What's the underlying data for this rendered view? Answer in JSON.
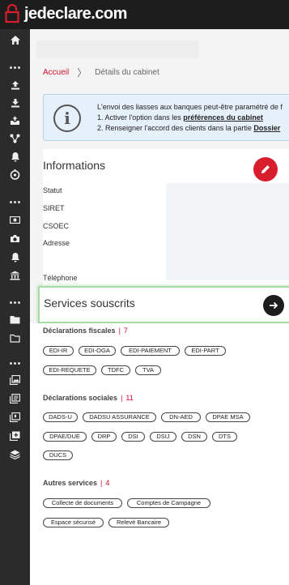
{
  "app": {
    "logo_text": "jedeclare.com"
  },
  "breadcrumb": {
    "home": "Accueil",
    "separator": "〉",
    "current": "Détails du cabinet"
  },
  "info_banner": {
    "line1": "L'envoi des liasses aux banques peut-être paramétré de f",
    "line2_prefix": "1. Activer l'option dans les ",
    "line2_link": "préférences du cabinet",
    "line3_prefix": "2. Renseigner l'accord des clients dans la partie ",
    "line3_link": "Dossier"
  },
  "informations": {
    "title": "Informations",
    "fields": [
      "Statut",
      "SIRET",
      "CSOEC",
      "Adresse",
      "Téléphone"
    ]
  },
  "services": {
    "title": "Services souscrits",
    "groups": [
      {
        "title": "Déclarations fiscales",
        "count": "7",
        "items": [
          "EDI-IR",
          "EDI-OGA",
          "EDI-PAIEMENT",
          "EDI-PART",
          "EDI-REQUETE",
          "TDFC",
          "TVA"
        ]
      },
      {
        "title": "Déclarations sociales",
        "count": "11",
        "items": [
          "DADS-U",
          "DADSU ASSURANCE",
          "DN-AED",
          "DPAE MSA",
          "DPAE/DUE",
          "DRP",
          "DSI",
          "DSIJ",
          "DSN",
          "DTS",
          "DUCS"
        ]
      },
      {
        "title": "Autres services",
        "count": "4",
        "items": [
          "Collecte de documents",
          "Comptes de Campagne",
          "Espace sécurisé",
          "Relevé Bancaire"
        ]
      }
    ]
  },
  "colors": {
    "brand_red": "#c8102e",
    "sidebar": "#2b2b2b",
    "topbar": "#1d1d1d",
    "highlight": "#a6dba6"
  },
  "sidebar_icons": [
    "home-icon",
    "upload-icon",
    "download-icon",
    "inbox-upload-icon",
    "network-icon",
    "bell-icon",
    "compass-icon",
    "cash-icon",
    "camera-icon",
    "bell-icon",
    "bank-icon",
    "folder-icon",
    "folder-outline-icon",
    "image-stack-icon",
    "document-stack-icon",
    "pdf-stack-icon",
    "add-stack-icon",
    "layers-icon"
  ]
}
